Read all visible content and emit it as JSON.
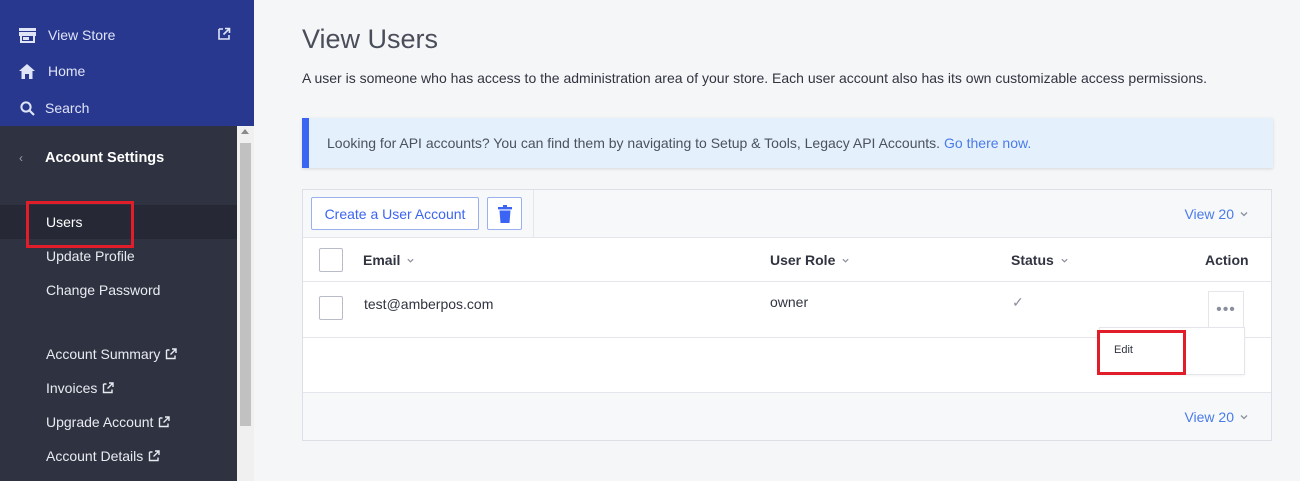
{
  "sidebar": {
    "top_nav": [
      {
        "label": "View Store",
        "icon": "store-icon"
      },
      {
        "label": "Home",
        "icon": "home-icon"
      },
      {
        "label": "Search",
        "icon": "search-icon"
      }
    ],
    "section_title": "Account Settings",
    "items": [
      {
        "label": "Users",
        "active": true
      },
      {
        "label": "Update Profile"
      },
      {
        "label": "Change Password"
      },
      {
        "label": "Account Summary",
        "external": true
      },
      {
        "label": "Invoices",
        "external": true
      },
      {
        "label": "Upgrade Account",
        "external": true
      },
      {
        "label": "Account Details",
        "external": true
      }
    ]
  },
  "main": {
    "title": "View Users",
    "description": "A user is someone who has access to the administration area of your store. Each user account also has its own customizable access permissions.",
    "alert": {
      "text": "Looking for API accounts? You can find them by navigating to Setup & Tools, Legacy API Accounts.",
      "link": "Go there now."
    },
    "toolbar": {
      "create_label": "Create a User Account",
      "view_label": "View 20"
    },
    "table": {
      "columns": [
        "Email",
        "User Role",
        "Status",
        "Action"
      ],
      "rows": [
        {
          "email": "test@amberpos.com",
          "role": "owner",
          "status": "✓"
        }
      ]
    },
    "action_menu": {
      "button": "•••",
      "items": [
        "Edit"
      ]
    },
    "footer": {
      "view_label": "View 20"
    }
  },
  "colors": {
    "topnav_bg": "#28388f",
    "sidebar_bg": "#2f3240",
    "accent": "#3c64f4",
    "link": "#4a7be8",
    "highlight": "#e11d2a"
  }
}
